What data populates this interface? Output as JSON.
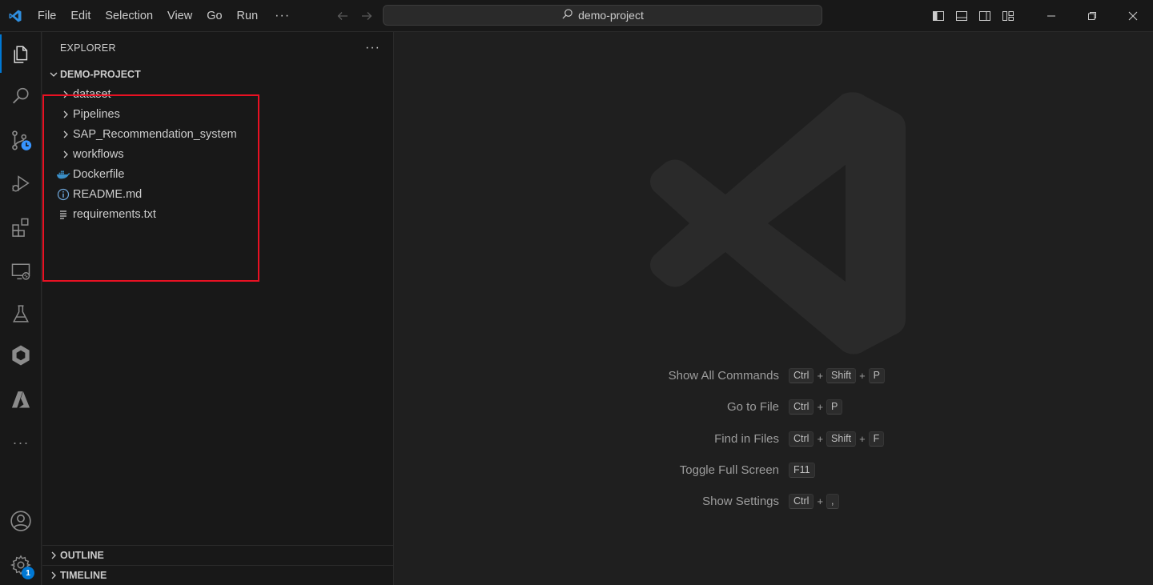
{
  "titlebar": {
    "menu": [
      "File",
      "Edit",
      "Selection",
      "View",
      "Go",
      "Run"
    ],
    "more": "···",
    "search_text": "demo-project"
  },
  "activitybar": {
    "items": [
      "explorer-icon",
      "search-icon",
      "source-control-icon",
      "run-debug-icon",
      "extensions-icon",
      "remote-explorer-icon",
      "testing-icon",
      "docker-icon",
      "azure-icon",
      "more-icon"
    ],
    "more": "···",
    "settings_badge": "1"
  },
  "sidebar": {
    "title": "EXPLORER",
    "more": "···",
    "project": "DEMO-PROJECT",
    "items": [
      {
        "label": "dataset",
        "type": "folder"
      },
      {
        "label": "Pipelines",
        "type": "folder"
      },
      {
        "label": "SAP_Recommendation_system",
        "type": "folder"
      },
      {
        "label": "workflows",
        "type": "folder"
      },
      {
        "label": "Dockerfile",
        "type": "docker"
      },
      {
        "label": "README.md",
        "type": "info"
      },
      {
        "label": "requirements.txt",
        "type": "text"
      }
    ],
    "outline": "OUTLINE",
    "timeline": "TIMELINE"
  },
  "editor": {
    "shortcuts": [
      {
        "label": "Show All Commands",
        "keys": [
          "Ctrl",
          "Shift",
          "P"
        ]
      },
      {
        "label": "Go to File",
        "keys": [
          "Ctrl",
          "P"
        ]
      },
      {
        "label": "Find in Files",
        "keys": [
          "Ctrl",
          "Shift",
          "F"
        ]
      },
      {
        "label": "Toggle Full Screen",
        "keys": [
          "F11"
        ]
      },
      {
        "label": "Show Settings",
        "keys": [
          "Ctrl",
          ","
        ]
      }
    ],
    "plus": "+"
  },
  "colors": {
    "accent": "#0078d4",
    "highlight": "#e81123",
    "logo": "#2a2a2a"
  }
}
